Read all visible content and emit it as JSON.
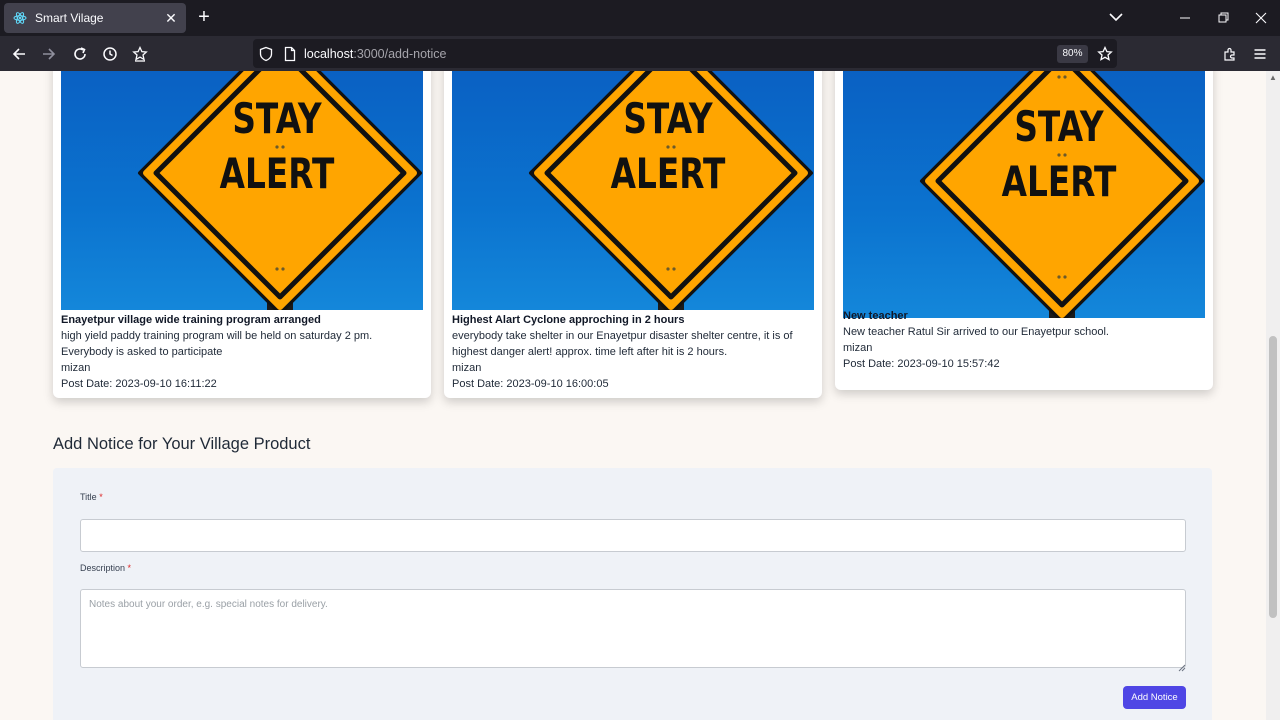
{
  "browser": {
    "tab_title": "Smart Vilage",
    "url_host": "localhost",
    "url_path": ":3000/add-notice",
    "zoom": "80%",
    "tab_favicon": "react-icon",
    "icons": [
      "back-icon",
      "forward-icon",
      "reload-icon",
      "history-icon",
      "bookmark-manager-icon",
      "shield-icon",
      "page-icon",
      "star-icon",
      "extensions-icon",
      "menu-icon"
    ]
  },
  "sign": {
    "line1": "STAY",
    "line2": "ALERT"
  },
  "notices": [
    {
      "title": "Enayetpur village wide training program arranged",
      "description": "high yield paddy training program will be held on saturday 2 pm. Everybody is asked to participate",
      "author": "mizan",
      "post_date": "Post Date: 2023-09-10 16:11:22"
    },
    {
      "title": "Highest Alart Cyclone approching in 2 hours",
      "description": "everybody take shelter in our Enayetpur disaster shelter centre, it is of highest danger alert! approx. time left after hit is 2 hours.",
      "author": "mizan",
      "post_date": "Post Date: 2023-09-10 16:00:05"
    },
    {
      "title": "New teacher",
      "description": "New teacher Ratul Sir arrived to our Enayetpur school.",
      "author": "mizan",
      "post_date": "Post Date: 2023-09-10 15:57:42"
    }
  ],
  "form": {
    "heading": "Add Notice for Your Village Product",
    "title_label": "Title",
    "title_value": "",
    "description_label": "Description",
    "description_placeholder": "Notes about your order, e.g. special notes for delivery.",
    "required_mark": "*",
    "submit_label": "Add Notice"
  },
  "colors": {
    "accent": "#4f46e5",
    "sign_yellow": "#ffa500",
    "sky_blue": "#0b6fcc",
    "required": "#dc2626"
  }
}
